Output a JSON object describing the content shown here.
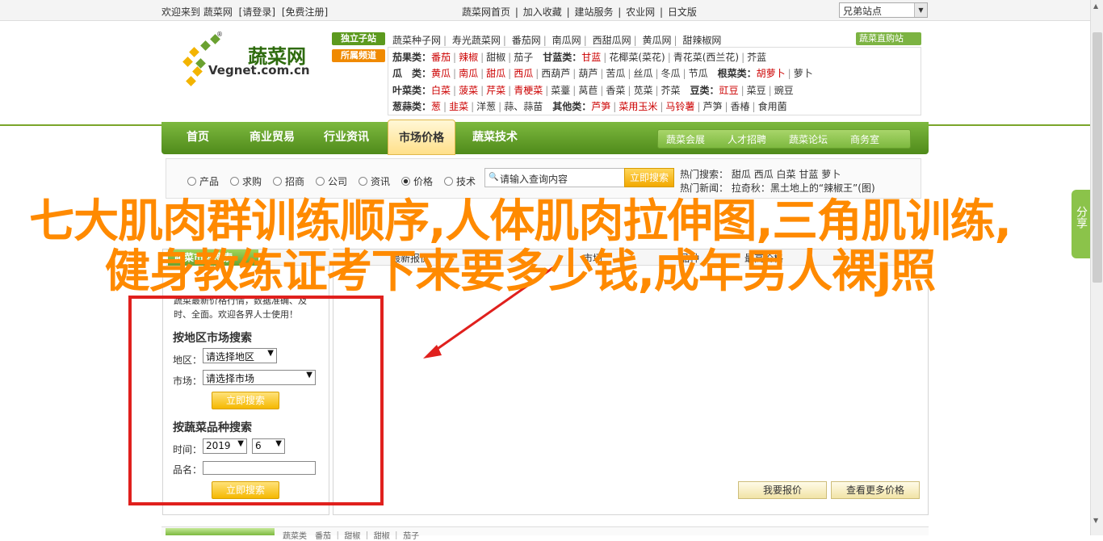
{
  "topbar": {
    "welcome": "欢迎来到 蔬菜网",
    "login": "[请登录]",
    "register": "[免费注册]",
    "links": [
      "蔬菜网首页",
      "|",
      "加入收藏",
      "|",
      "建站服务",
      "|",
      "农业网",
      "|",
      "日文版"
    ],
    "friend_select": "兄弟站点"
  },
  "logo": {
    "cn": "蔬菜网",
    "en": "Vegnet.com.cn",
    "reg": "®"
  },
  "subsites": {
    "independent": "独立子站",
    "belong": "所属频道",
    "portal": "蔬菜直购站"
  },
  "subsite_links": [
    "蔬菜种子网",
    "寿光蔬菜网",
    "番茄网",
    "南瓜网",
    "西甜瓜网",
    "黄瓜网",
    "甜辣椒网"
  ],
  "categories": [
    {
      "label": "茄果类：",
      "items": [
        "番茄",
        "辣椒",
        "甜椒",
        "茄子"
      ],
      "red": [
        0,
        1
      ],
      "label2": "甘蓝类：",
      "items2": [
        "甘蓝",
        "花椰菜(菜花)",
        "青花菜(西兰花)",
        "芥蓝"
      ],
      "red2": [
        0
      ]
    },
    {
      "label": "瓜　类：",
      "items": [
        "黄瓜",
        "南瓜",
        "甜瓜",
        "西瓜",
        "西葫芦",
        "葫芦",
        "苦瓜",
        "丝瓜",
        "冬瓜",
        "节瓜"
      ],
      "red": [
        0,
        1,
        2,
        3
      ],
      "label2": "根菜类：",
      "items2": [
        "胡萝卜",
        "萝卜"
      ],
      "red2": [
        0
      ]
    },
    {
      "label": "叶菜类：",
      "items": [
        "白菜",
        "菠菜",
        "芹菜",
        "青梗菜",
        "菜薹",
        "莴苣",
        "香菜",
        "苋菜",
        "芥菜"
      ],
      "red": [
        0,
        1,
        2,
        3
      ],
      "label2": "豆类：",
      "items2": [
        "豇豆",
        "菜豆",
        "豌豆"
      ],
      "red2": [
        0
      ]
    },
    {
      "label": "葱蒜类：",
      "items": [
        "葱",
        "韭菜",
        "洋葱",
        "蒜、蒜苗"
      ],
      "red": [
        0,
        1
      ],
      "label2": "其他类：",
      "items2": [
        "芦笋",
        "菜用玉米",
        "马铃薯",
        "芦笋",
        "香椿",
        "食用菌"
      ],
      "red2": [
        0,
        1,
        2
      ]
    }
  ],
  "nav": {
    "items": [
      "首页",
      "商业贸易",
      "行业资讯",
      "市场价格",
      "蔬菜技术"
    ],
    "right": [
      "蔬菜会展",
      "人才招聘",
      "蔬菜论坛",
      "商务室"
    ]
  },
  "search": {
    "options": [
      "产品",
      "求购",
      "招商",
      "公司",
      "资讯",
      "价格",
      "技术"
    ],
    "selected": "价格",
    "placeholder": "请输入查询内容",
    "button": "立即搜索",
    "hot_label": "热门搜索：",
    "hot_items": [
      "甜瓜",
      "西瓜",
      "白菜",
      "甘蓝",
      "萝卜"
    ],
    "news_label": "热门新闻：",
    "news_text": "拉奇秋：黑土地上的“辣椒王”(图)"
  },
  "tabs": {
    "green": "蔬菜市场搜索",
    "items": [
      "最新报价",
      "市场",
      "品种",
      "最高价格"
    ]
  },
  "left_panel": {
    "intro1": "蔬菜最新价格行情，数据准确、及",
    "intro2": "时、全面。欢迎各界人士使用！",
    "area_title": "按地区市场搜索",
    "area_label": "地区：",
    "area_value": "请选择地区",
    "market_label": "市场：",
    "market_value": "请选择市场",
    "search_btn": "立即搜索",
    "variety_title": "按蔬菜品种搜索",
    "time_label": "时间：",
    "year": "2019",
    "month": "6",
    "name_label": "品名：",
    "search_btn2": "立即搜索"
  },
  "buttons": {
    "my_quote": "我要报价",
    "more_prices": "查看更多价格"
  },
  "bottom": {
    "text": "蔬菜类　番茄 ｜ 甜椒 ｜ 甜椒 ｜ 茄子"
  },
  "side_tab": "分享",
  "overlay_title": "七大肌肉群训练顺序,人体肌肉拉伸图,三角肌训练,健身教练证考下来要多少钱,成年男人裸j照",
  "colors": {
    "brand_green": "#5c9a1e",
    "accent_orange": "#ff8a00",
    "red_frame": "#e0201d"
  }
}
